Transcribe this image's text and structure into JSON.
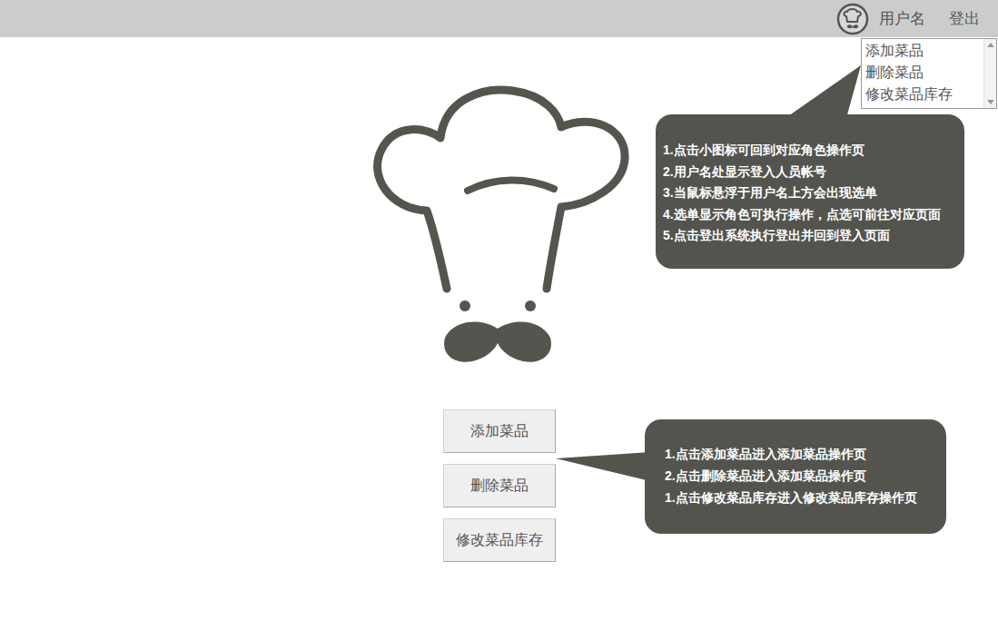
{
  "header": {
    "username": "用户名",
    "logout": "登出"
  },
  "user_menu": {
    "expanded": true,
    "items": [
      "添加菜品",
      "删除菜品",
      "修改菜品库存"
    ]
  },
  "buttons": [
    "添加菜品",
    "删除菜品",
    "修改菜品库存"
  ],
  "annotations": [
    {
      "lines": [
        "1.点击小图标可回到对应角色操作页",
        "2.用户名处显示登入人员帐号",
        "3.当鼠标悬浮于用户名上方会出现选单",
        "4.选单显示角色可执行操作，点选可前往对应页面",
        "5.点击登出系统执行登出并回到登入页面"
      ]
    },
    {
      "lines": [
        "1.点击添加菜品进入添加菜品操作页",
        "2.点击删除菜品进入添加菜品操作页",
        "1.点击修改菜品库存进入修改菜品库存操作页"
      ]
    }
  ]
}
